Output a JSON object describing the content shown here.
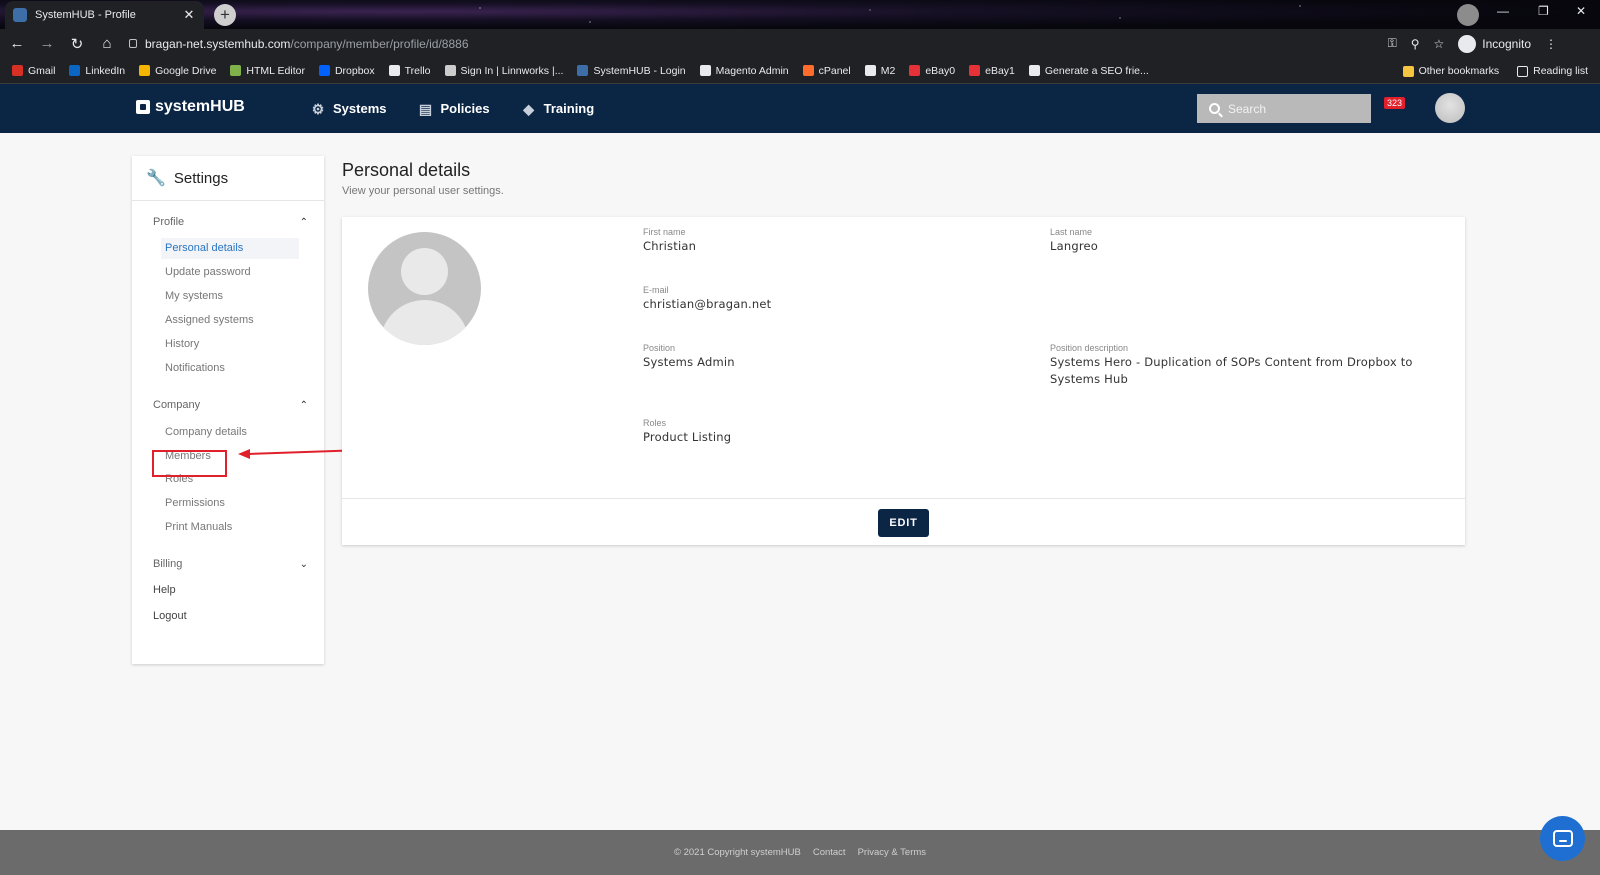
{
  "browser": {
    "tab_title": "SystemHUB - Profile",
    "tab_close": "✕",
    "new_tab": "+",
    "url_host": "bragan-net.systemhub.com",
    "url_path": "/company/member/profile/id/8886",
    "incognito_label": "Incognito",
    "bookmarks": [
      {
        "label": "Gmail",
        "color": "#d93025"
      },
      {
        "label": "LinkedIn",
        "color": "#0a66c2"
      },
      {
        "label": "Google Drive",
        "color": "#f4b400"
      },
      {
        "label": "HTML Editor",
        "color": "#7fb24a"
      },
      {
        "label": "Dropbox",
        "color": "#0061ff"
      },
      {
        "label": "Trello",
        "color": "#e8eaed"
      },
      {
        "label": "Sign In | Linnworks |...",
        "color": "#cccccc"
      },
      {
        "label": "SystemHUB - Login",
        "color": "#3d6ea8"
      },
      {
        "label": "Magento Admin",
        "color": "#e8eaed"
      },
      {
        "label": "cPanel",
        "color": "#ff6c2c"
      },
      {
        "label": "M2",
        "color": "#e8eaed"
      },
      {
        "label": "eBay0",
        "color": "#e53238"
      },
      {
        "label": "eBay1",
        "color": "#e53238"
      },
      {
        "label": "Generate a SEO frie...",
        "color": "#e8eaed"
      }
    ],
    "other_bookmarks": "Other bookmarks",
    "reading_list": "Reading list"
  },
  "app": {
    "logo_text": "systemHUB",
    "nav": [
      {
        "label": "Systems",
        "icon": "⚙"
      },
      {
        "label": "Policies",
        "icon": "▤"
      },
      {
        "label": "Training",
        "icon": "◆"
      }
    ],
    "search_placeholder": "Search",
    "notification_count": "323"
  },
  "sidebar": {
    "title": "Settings",
    "profile_section": "Profile",
    "profile_items": [
      "Personal details",
      "Update password",
      "My systems",
      "Assigned systems",
      "History",
      "Notifications"
    ],
    "company_section": "Company",
    "company_items": [
      "Company details",
      "Members",
      "Roles",
      "Permissions",
      "Print Manuals"
    ],
    "billing_section": "Billing",
    "help": "Help",
    "logout": "Logout"
  },
  "main": {
    "title": "Personal details",
    "subtitle": "View your personal user settings.",
    "first_name_label": "First name",
    "first_name": "Christian",
    "last_name_label": "Last name",
    "last_name": "Langreo",
    "email_label": "E-mail",
    "email": "christian@bragan.net",
    "position_label": "Position",
    "position": "Systems Admin",
    "position_desc_label": "Position description",
    "position_desc": "Systems Hero - Duplication of SOPs Content from Dropbox to Systems Hub",
    "roles_label": "Roles",
    "roles": "Product Listing",
    "edit_label": "EDIT"
  },
  "footer": {
    "copyright": "© 2021 Copyright systemHUB",
    "contact": "Contact",
    "privacy": "Privacy & Terms"
  },
  "colors": {
    "nav_bg": "#0b2545",
    "active_link": "#2a75c2",
    "annotation_red": "#e0202a"
  }
}
